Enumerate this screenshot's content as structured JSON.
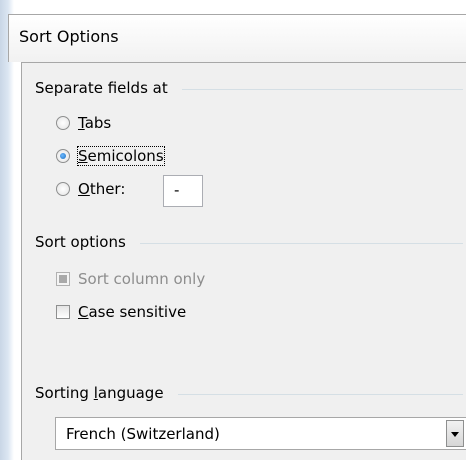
{
  "dialog": {
    "title": "Sort Options"
  },
  "separate_fields": {
    "heading_pre": "Separate fields at",
    "tabs": {
      "underline": "T",
      "rest": "abs",
      "checked": false
    },
    "semicolons": {
      "underline": "S",
      "rest": "emicolons",
      "checked": true
    },
    "other": {
      "underline": "O",
      "rest": "ther:",
      "checked": false,
      "value": "-"
    }
  },
  "sort_options": {
    "heading": "Sort options",
    "sort_column_only": {
      "label": "Sort column only",
      "checked": false,
      "disabled": true
    },
    "case_sensitive": {
      "underline": "C",
      "rest": "ase sensitive",
      "checked": false
    }
  },
  "sorting_language": {
    "heading_pre": "Sorting ",
    "heading_underline": "l",
    "heading_post": "anguage",
    "selected": "French (Switzerland)"
  }
}
